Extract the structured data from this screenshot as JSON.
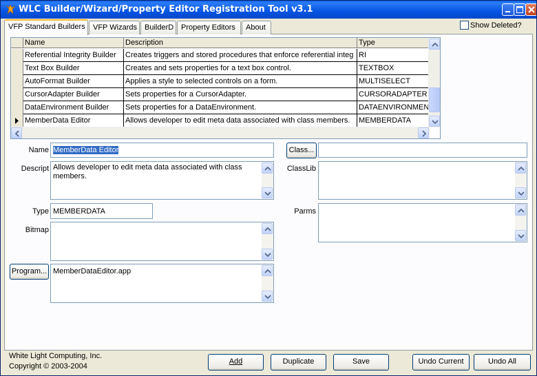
{
  "window": {
    "title": "WLC Builder/Wizard/Property Editor Registration Tool v3.1"
  },
  "tabs": [
    {
      "label": "VFP Standard Builders",
      "active": true
    },
    {
      "label": "VFP Wizards",
      "active": false
    },
    {
      "label": "BuilderD",
      "active": false
    },
    {
      "label": "Property Editors",
      "active": false
    },
    {
      "label": "About",
      "active": false
    }
  ],
  "show_deleted": {
    "label": "Show Deleted?",
    "checked": false
  },
  "grid": {
    "columns": [
      "Name",
      "Description",
      "Type"
    ],
    "rows": [
      {
        "name": "Referential Integrity Builder",
        "description": "Creates triggers and stored procedures that enforce referential integ",
        "type": "RI"
      },
      {
        "name": "Text Box Builder",
        "description": "Creates and sets properties for a text box control.",
        "type": "TEXTBOX"
      },
      {
        "name": "AutoFormat Builder",
        "description": "Applies a style to selected controls on a form.",
        "type": "MULTISELECT"
      },
      {
        "name": "CursorAdapter Builder",
        "description": "Sets properties for a CursorAdapter.",
        "type": "CURSORADAPTER"
      },
      {
        "name": "DataEnvironment Builder",
        "description": "Sets properties for a DataEnvironment.",
        "type": "DATAENVIRONMENT"
      },
      {
        "name": "MemberData Editor",
        "description": "Allows developer to edit meta data associated with class members.",
        "type": "MEMBERDATA"
      }
    ]
  },
  "form": {
    "name_label": "Name",
    "name_value": "MemberData Editor",
    "descript_label": "Descript",
    "descript_value": "Allows developer to edit meta data associated with class members.",
    "type_label": "Type",
    "type_value": "MEMBERDATA",
    "bitmap_label": "Bitmap",
    "bitmap_value": "",
    "program_button": "Program...",
    "program_value": "MemberDataEditor.app",
    "class_button": "Class...",
    "class_value": "",
    "classlib_label": "ClassLib",
    "classlib_value": "",
    "parms_label": "Parms",
    "parms_value": ""
  },
  "footer": {
    "company": "White Light Computing, Inc.",
    "copyright": "Copyright © 2003-2004"
  },
  "buttons": {
    "add": "Add",
    "duplicate": "Duplicate",
    "save": "Save",
    "undo_current": "Undo Current",
    "undo_all": "Undo All"
  }
}
